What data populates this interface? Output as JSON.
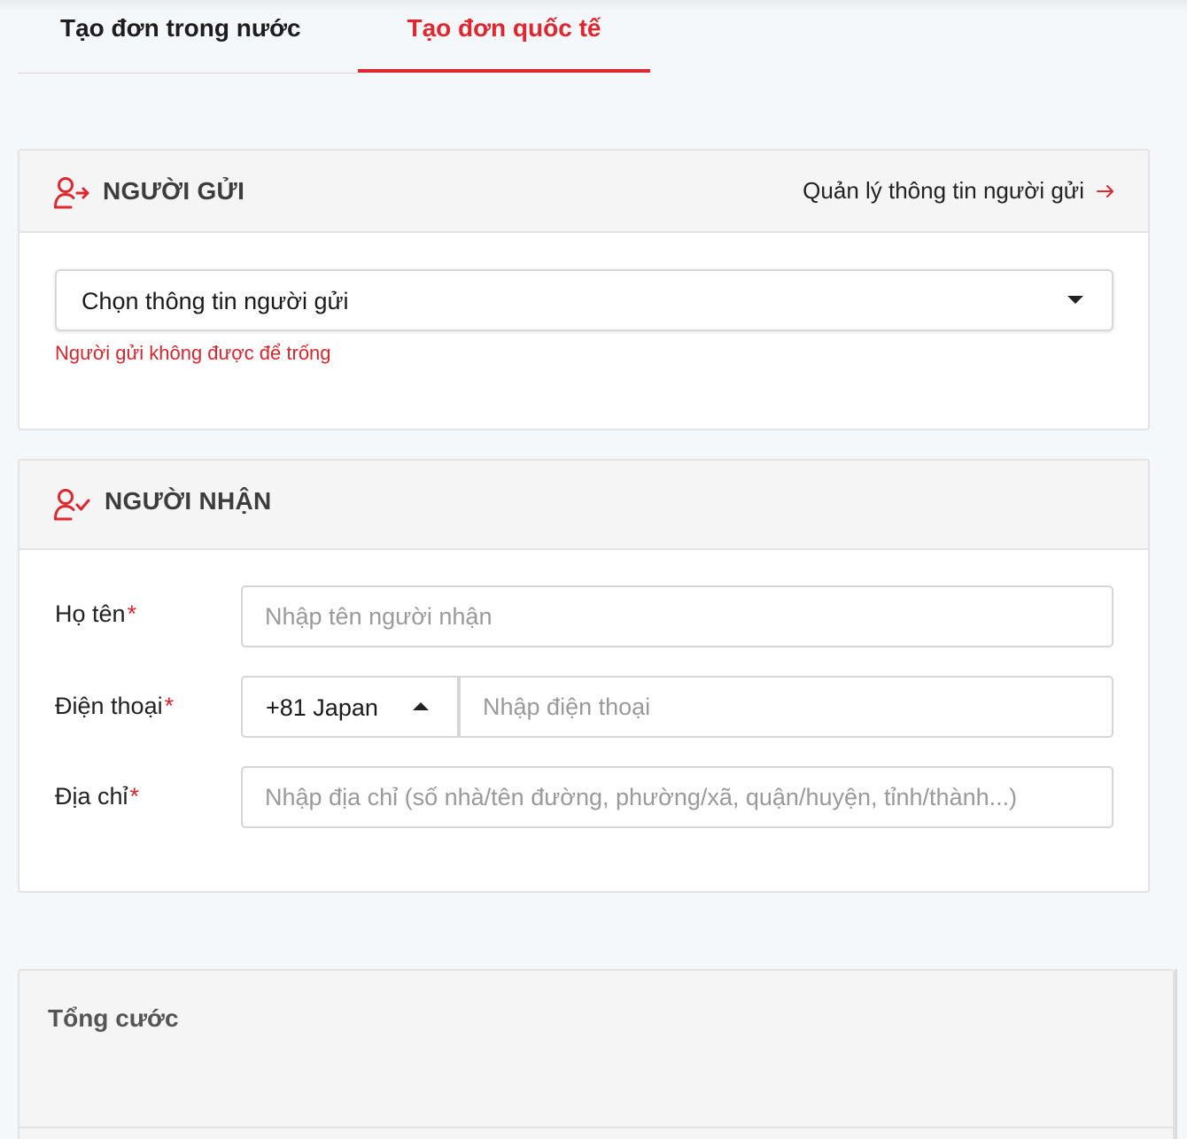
{
  "tabs": {
    "domestic": "Tạo đơn trong nước",
    "international": "Tạo đơn quốc tế",
    "active": "international"
  },
  "sender": {
    "title": "NGƯỜI GỬI",
    "manage_link": "Quản lý thông tin người gửi",
    "select_value": "Chọn thông tin người gửi",
    "error": "Người gửi không được để trống",
    "icon": "user-send-icon"
  },
  "receiver": {
    "title": "NGƯỜI NHẬN",
    "icon": "user-check-icon",
    "name_label": "Họ tên",
    "name_placeholder": "Nhập tên người nhận",
    "phone_label": "Điện thoại",
    "country_code": "+81 Japan",
    "phone_placeholder": "Nhập điện thoại",
    "address_label": "Địa chỉ",
    "address_placeholder": "Nhập địa chỉ (số nhà/tên đường, phường/xã, quận/huyện, tỉnh/thành...)",
    "required_mark": "*"
  },
  "total": {
    "title": "Tổng cước"
  },
  "colors": {
    "accent": "#e0262e",
    "panel_header": "#f5f5f5",
    "background": "#f5f8fb"
  }
}
